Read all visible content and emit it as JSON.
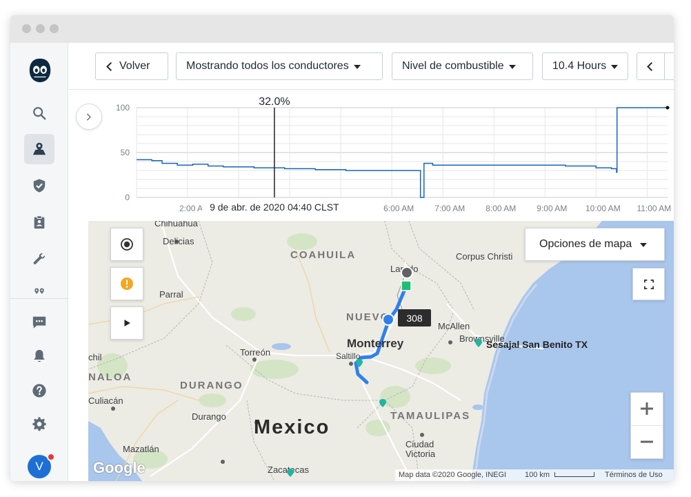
{
  "toolbar": {
    "back_label": "Volver",
    "drivers_filter": "Mostrando todos los conductores",
    "metric_select": "Nivel de combustible",
    "range_select": "10.4 Hours"
  },
  "chart_data": {
    "type": "line",
    "cursor_value": "32.0%",
    "cursor_timestamp": "9 de abr. de 2020 04:40 CLST",
    "y_ticks": [
      "100",
      "50",
      "0"
    ],
    "x_ticks": [
      "2:00 AM",
      "6:00 AM",
      "7:00 AM",
      "8:00 AM",
      "9:00 AM",
      "10:00 AM",
      "11:00 AM"
    ],
    "ylim": [
      0,
      100
    ],
    "grid": true,
    "series": [
      {
        "color": "#1565c0",
        "points": [
          [
            0.0,
            42
          ],
          [
            0.3,
            41
          ],
          [
            0.5,
            38
          ],
          [
            0.8,
            36
          ],
          [
            1.1,
            37
          ],
          [
            1.4,
            35
          ],
          [
            1.7,
            34
          ],
          [
            2.0,
            34
          ],
          [
            2.3,
            33
          ],
          [
            2.6,
            33
          ],
          [
            2.9,
            32
          ],
          [
            3.2,
            32
          ],
          [
            3.5,
            31
          ],
          [
            3.8,
            31
          ],
          [
            4.1,
            30
          ],
          [
            4.4,
            30
          ],
          [
            4.8,
            30
          ],
          [
            5.1,
            30
          ],
          [
            5.55,
            30
          ],
          [
            5.56,
            0
          ],
          [
            5.62,
            0
          ],
          [
            5.63,
            38
          ],
          [
            5.8,
            36
          ],
          [
            6.1,
            36
          ],
          [
            6.6,
            36
          ],
          [
            7.1,
            36
          ],
          [
            7.6,
            36
          ],
          [
            8.1,
            36
          ],
          [
            8.4,
            35
          ],
          [
            8.7,
            35
          ],
          [
            9.0,
            33
          ],
          [
            9.3,
            32
          ],
          [
            9.4,
            28
          ],
          [
            9.41,
            100
          ],
          [
            10.4,
            100
          ]
        ]
      }
    ]
  },
  "map": {
    "map_options_label": "Opciones de mapa",
    "places": {
      "chihuahua": "Chihuahua",
      "delicias": "Delicias",
      "parral": "Parral",
      "torreon": "Torreón",
      "durango_city": "Durango",
      "chil": "chil",
      "culiacan": "Culiacán",
      "mazatlan": "Mazatlán",
      "zacatecas": "Zacatecas",
      "monterrey": "Monterrey",
      "saltillo": "Saltillo",
      "laredo": "Laredo",
      "corpus": "Corpus Christi",
      "mcallen": "McAllen",
      "brownsville": "Brownsville",
      "victoria": "Ciudad\nVictoria",
      "mexico": "Mexico"
    },
    "states": {
      "coahuila": "COAHUILA",
      "nuevo": "NUEVO",
      "durango": "DURANGO",
      "naloa": "NALOA",
      "tamaulipas": "TAMAULIPAS"
    },
    "poi_label": "Sesajal San Benito TX",
    "vehicle_badge": "308",
    "attribution": "Map data ©2020 Google, INEGI",
    "scale_label": "100 km",
    "terms_label": "Términos de Uso",
    "logo_text": "Google"
  },
  "colors": {
    "route": "#2f80ed",
    "water": "#a9c6ec",
    "land": "#ecebe4",
    "poi": "#1fb5a3",
    "warning": "#f5a623"
  },
  "icons": [
    "logo-icon",
    "search-icon",
    "map-route-icon",
    "shield-check-icon",
    "clipboard-badge-icon",
    "wrench-icon",
    "pins-icon",
    "chat-icon",
    "bell-icon",
    "help-icon",
    "gear-icon",
    "chevron-left-icon",
    "chevron-right-icon",
    "record-icon",
    "warning-icon",
    "play-icon",
    "fullscreen-icon",
    "zoom-in-icon",
    "zoom-out-icon"
  ]
}
